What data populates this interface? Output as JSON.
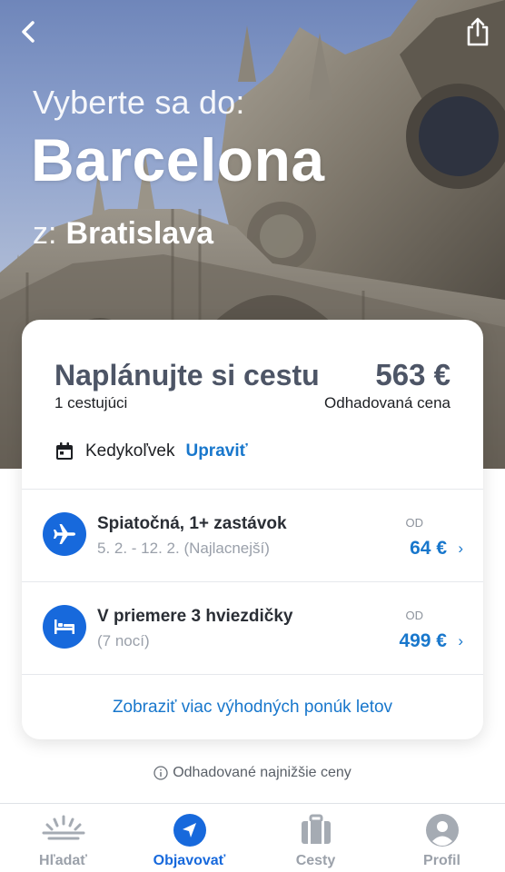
{
  "hero": {
    "prefix": "Vyberte sa do:",
    "destination": "Barcelona",
    "from_prefix": "z:",
    "origin": "Bratislava"
  },
  "plan": {
    "title": "Naplánujte si cestu",
    "price": "563 €",
    "travelers": "1 cestujúci",
    "price_caption": "Odhadovaná cena",
    "when": "Kedykoľvek",
    "edit_label": "Upraviť"
  },
  "offers": [
    {
      "icon": "airplane-icon",
      "title": "Spiatočná, 1+ zastávok",
      "subtitle": "5. 2. - 12. 2. (Najlacnejší)",
      "from_label": "OD",
      "price": "64 €"
    },
    {
      "icon": "bed-icon",
      "title": "V priemere 3 hviezdičky",
      "subtitle": "(7 nocí)",
      "from_label": "OD",
      "price": "499 €"
    }
  ],
  "more_link": "Zobraziť viac výhodných ponúk letov",
  "note": "Odhadované najnižšie ceny",
  "tabs": [
    {
      "label": "Hľadať",
      "icon": "sunrise-icon",
      "active": false
    },
    {
      "label": "Objavovať",
      "icon": "compass-icon",
      "active": true
    },
    {
      "label": "Cesty",
      "icon": "suitcase-icon",
      "active": false
    },
    {
      "label": "Profil",
      "icon": "person-icon",
      "active": false
    }
  ],
  "colors": {
    "accent": "#1769dc",
    "link": "#1877cc",
    "title_gray": "#4d5566",
    "inactive_tab": "#9ba1aa"
  }
}
